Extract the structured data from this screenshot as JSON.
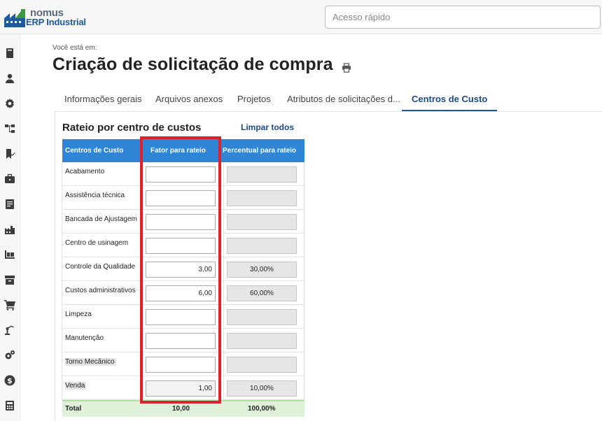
{
  "app": {
    "logo_name": "nomus",
    "logo_sub": "ERP Industrial"
  },
  "header": {
    "quick_access_placeholder": "Acesso rápido"
  },
  "sidebar": {
    "icons": [
      "book-icon",
      "user-icon",
      "gear-icon",
      "hierarchy-icon",
      "bookmark-check-icon",
      "briefcase-icon",
      "document-icon",
      "factory-icon",
      "pallet-icon",
      "archive-icon",
      "cart-icon",
      "robot-arm-icon",
      "gears-icon",
      "dollar-icon",
      "calculator-icon"
    ]
  },
  "breadcrumb": {
    "label": "Você está em:"
  },
  "page": {
    "title": "Criação de solicitação de compra"
  },
  "tabs": [
    {
      "label": "Informações gerais",
      "active": false
    },
    {
      "label": "Arquivos anexos",
      "active": false
    },
    {
      "label": "Projetos",
      "active": false
    },
    {
      "label": "Atributos de solicitações d...",
      "active": false
    },
    {
      "label": "Centros de Custo",
      "active": true
    }
  ],
  "section": {
    "title": "Rateio por centro de custos",
    "clear_all": "Limpar todos"
  },
  "table": {
    "headers": {
      "centro": "Centros de Custo",
      "fator": "Fator para rateio",
      "percentual": "Percentual para rateio"
    },
    "rows": [
      {
        "centro": "Acabamento",
        "fator": "",
        "percentual": ""
      },
      {
        "centro": "Assistência técnica",
        "fator": "",
        "percentual": ""
      },
      {
        "centro": "Bancada de Ajustagem",
        "fator": "",
        "percentual": ""
      },
      {
        "centro": "Centro de usinagem",
        "fator": "",
        "percentual": ""
      },
      {
        "centro": "Controle da Qualidade",
        "fator": "3,00",
        "percentual": "30,00%"
      },
      {
        "centro": "Custos administrativos",
        "fator": "6,00",
        "percentual": "60,00%"
      },
      {
        "centro": "Limpeza",
        "fator": "",
        "percentual": ""
      },
      {
        "centro": "Manutenção",
        "fator": "",
        "percentual": ""
      },
      {
        "centro": "Torno Mecânico",
        "fator": "",
        "percentual": ""
      },
      {
        "centro": "Venda",
        "fator": "1,00",
        "percentual": "10,00%"
      }
    ],
    "total": {
      "label": "Total",
      "fator": "10,00",
      "percentual": "100,00%"
    }
  },
  "colors": {
    "header_blue": "#2f86d6",
    "highlight_red": "#e0202a",
    "total_green": "#dff1d8",
    "tab_active": "#1d4a86"
  }
}
